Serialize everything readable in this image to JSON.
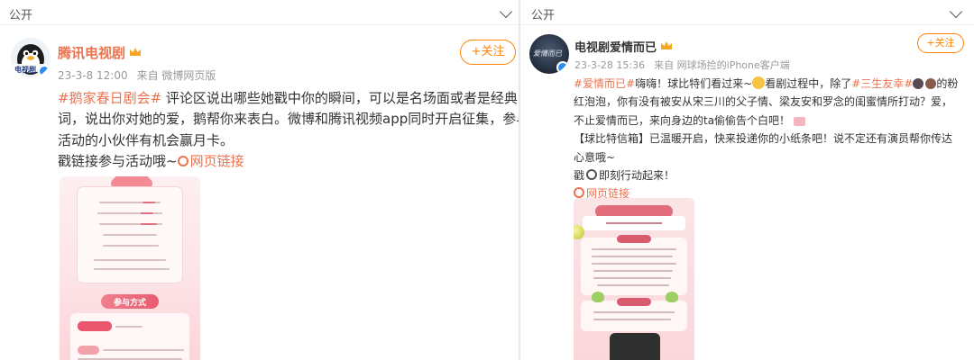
{
  "left_post": {
    "section_title": "公开",
    "username": "腾讯电视剧",
    "avatar_text": "电视剧",
    "timestamp": "23-3-8 12:00",
    "source": "来自 微博网页版",
    "follow_label": "+关注",
    "lines": [
      {
        "tag": "#鹅家春日剧会#",
        "text": " 评论区说出哪些她戳中你的瞬间，可以是名场面或者是经典台"
      },
      {
        "text": "词，说出你对她的爱，鹅帮你来表白。微博和腾讯视频app同时开启征集，参与"
      },
      {
        "text": "活动的小伙伴有机会赢月卡。"
      },
      {
        "text": "戳链接参与活动哦~",
        "link": "网页链接"
      }
    ],
    "poster": {
      "banner": "参与方式"
    }
  },
  "right_post": {
    "section_title": "公开",
    "username": "电视剧爱情而已",
    "avatar_text": "爱情而已",
    "timestamp": "23-3-28 15:36",
    "source": "来自 网球场捡的iPhone客户端",
    "follow_label": "+关注",
    "lines": [
      {
        "tag": "#爱情而已#",
        "text": "嗨嗨！球比特们看过来~",
        "emoji": "face-emoji",
        "text2": "看剧过程中，除了",
        "tag2": "#三生友幸#",
        "emoji2": "girls-emoji",
        "text3": "的粉"
      },
      {
        "text": "红泡泡，你有没有被安从宋三川的父子情、梁友安和罗念的闺蜜情所打动？爱，"
      },
      {
        "text": "不止爱情而已，来向身边的ta偷偷告个白吧！",
        "emoji": "heart-letter-emoji"
      },
      {
        "text": "【球比特信箱】已温暖开启，快来投递你的小纸条吧！说不定还有演员帮你传达"
      },
      {
        "text": "心意哦~"
      },
      {
        "text": "戳",
        "emoji": "link-emoji",
        "text2": "即刻行动起来！"
      },
      {
        "link": "网页链接"
      }
    ]
  },
  "colors": {
    "accent": "#ff8200",
    "link": "#eb7350",
    "meta": "#999999",
    "poster_pink": "#fbd3d8"
  }
}
